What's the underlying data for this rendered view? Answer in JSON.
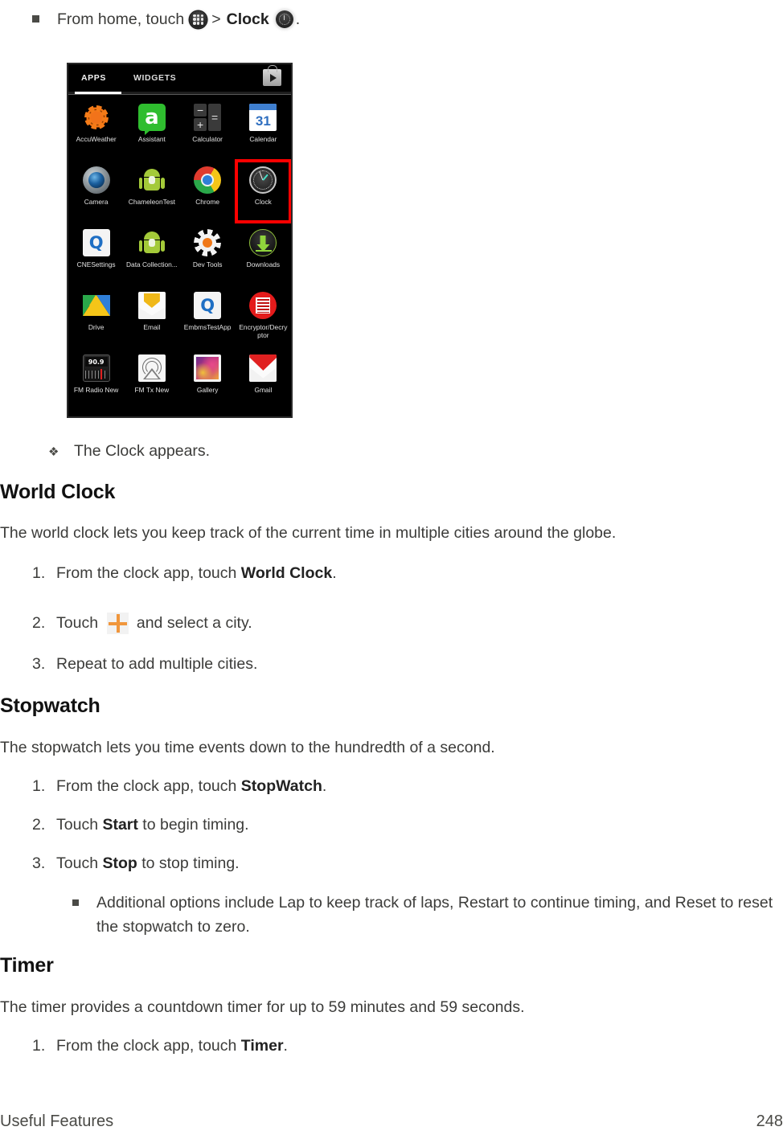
{
  "intro_bullet": {
    "text_before": "From home, touch",
    "apps_icon": "apps-grid-icon",
    "separator": ">",
    "bold_label": "Clock",
    "clock_icon": "clock-face-icon",
    "text_after": "."
  },
  "phone_screenshot": {
    "tabs": [
      {
        "label": "APPS",
        "active": true
      },
      {
        "label": "WIDGETS",
        "active": false
      }
    ],
    "play_store_icon": "play-store-bag-icon",
    "highlighted_app": "Clock",
    "highlight_color": "#ff0000",
    "rows": [
      [
        {
          "label": "AccuWeather",
          "icon": "accuweather-sun-icon"
        },
        {
          "label": "Assistant",
          "icon": "assistant-a-icon"
        },
        {
          "label": "Calculator",
          "icon": "calculator-keys-icon"
        },
        {
          "label": "Calendar",
          "icon": "calendar-31-icon"
        }
      ],
      [
        {
          "label": "Camera",
          "icon": "camera-lens-icon"
        },
        {
          "label": "ChameleonTest",
          "icon": "android-robot-icon"
        },
        {
          "label": "Chrome",
          "icon": "chrome-icon"
        },
        {
          "label": "Clock",
          "icon": "clock-app-icon"
        }
      ],
      [
        {
          "label": "CNESettings",
          "icon": "qualcomm-q-icon"
        },
        {
          "label": "Data Collection...",
          "icon": "android-robot-icon"
        },
        {
          "label": "Dev Tools",
          "icon": "gear-icon"
        },
        {
          "label": "Downloads",
          "icon": "download-arrow-icon"
        }
      ],
      [
        {
          "label": "Drive",
          "icon": "google-drive-icon"
        },
        {
          "label": "Email",
          "icon": "email-envelope-icon"
        },
        {
          "label": "EmbmsTestApp",
          "icon": "qualcomm-q-icon"
        },
        {
          "label": "Encryptor/Decryptor",
          "icon": "encryptor-icon"
        }
      ],
      [
        {
          "label": "FM Radio New",
          "icon": "fm-radio-icon"
        },
        {
          "label": "FM Tx New",
          "icon": "fm-transmitter-icon"
        },
        {
          "label": "Gallery",
          "icon": "gallery-photo-icon"
        },
        {
          "label": "Gmail",
          "icon": "gmail-envelope-icon"
        }
      ]
    ],
    "fm_radio_display": "90.9"
  },
  "result_note": {
    "bullet": "❖",
    "text": "The Clock appears."
  },
  "sections": [
    {
      "heading": "World Clock",
      "intro": "The world clock lets you keep track of the current time in multiple cities around the globe.",
      "steps": [
        {
          "num": "1.",
          "before": "From the clock app, touch ",
          "bold": "World Clock",
          "after": "."
        },
        {
          "num": "2.",
          "before": "Touch ",
          "icon": "plus-icon",
          "after": " and select a city."
        },
        {
          "num": "3.",
          "before": "Repeat to add multiple cities.",
          "bold": "",
          "after": ""
        }
      ]
    },
    {
      "heading": "Stopwatch",
      "intro": "The stopwatch lets you time events down to the hundredth of a second.",
      "steps": [
        {
          "num": "1.",
          "before": "From the clock app, touch ",
          "bold": "StopWatch",
          "after": "."
        },
        {
          "num": "2.",
          "before": "Touch ",
          "bold": "Start",
          "after": " to begin timing."
        },
        {
          "num": "3.",
          "before": "Touch ",
          "bold": "Stop",
          "after": " to stop timing."
        }
      ],
      "sub_note": "Additional options include Lap to keep track of laps, Restart to continue timing, and Reset to reset the stopwatch to zero."
    },
    {
      "heading": "Timer",
      "intro": "The timer provides a countdown timer for up to 59 minutes and 59 seconds.",
      "steps": [
        {
          "num": "1.",
          "before": "From the clock app, touch ",
          "bold": "Timer",
          "after": "."
        }
      ]
    }
  ],
  "footer": {
    "left": "Useful Features",
    "right": "248"
  }
}
